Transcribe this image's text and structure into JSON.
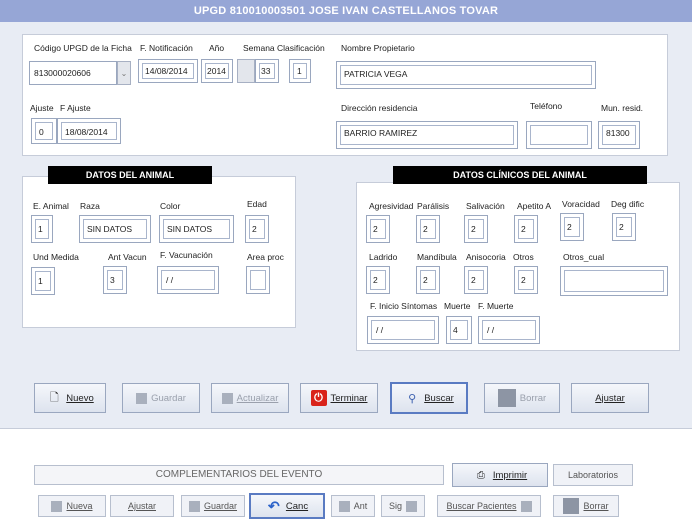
{
  "window": {
    "title": "UPGD 810010003501 JOSE IVAN CASTELLANOS TOVAR"
  },
  "top": {
    "labels": {
      "codigo": "Código UPGD de la Ficha",
      "notificacion": "F. Notificación",
      "anio": "Año",
      "semana": "Semana Clasificación",
      "propietario": "Nombre Propietario",
      "ajuste": "Ajuste",
      "fajuste": "F Ajuste",
      "direccion": "Dirección residencia",
      "telefono": "Teléfono",
      "mun": "Mun. resid."
    },
    "values": {
      "codigo": "813000020606",
      "notificacion": "14/08/2014",
      "anio": "2014",
      "semana": "33",
      "clasificacion": "1",
      "propietario": "PATRICIA VEGA",
      "ajuste": "0",
      "fajuste": "18/08/2014",
      "direccion": "BARRIO RAMIREZ",
      "telefono": "",
      "mun": "81300"
    }
  },
  "animal": {
    "header": "DATOS DEL ANIMAL",
    "labels": {
      "eanimal": "E. Animal",
      "raza": "Raza",
      "color": "Color",
      "edad": "Edad",
      "und": "Und Medida",
      "antvacun": "Ant Vacun",
      "fvacunacion": "F. Vacunación",
      "area": "Area proc"
    },
    "values": {
      "eanimal": "1",
      "raza": "SIN DATOS",
      "color": "SIN DATOS",
      "edad": "2",
      "und": "1",
      "antvacun": "3",
      "fvacunacion": "/ /",
      "area": ""
    }
  },
  "clinicos": {
    "header": "DATOS CLÍNICOS DEL ANIMAL",
    "labels": {
      "agresividad": "Agresividad",
      "paralisis": "Parálisis",
      "salivacion": "Salivación",
      "apetito": "Apetito A",
      "voracidad": "Voracidad",
      "degdific": "Deg dific",
      "ladrido": "Ladrido",
      "mandibula": "Mandíbula",
      "anisocoria": "Anisocoria",
      "otros": "Otros",
      "otroscual": "Otros_cual",
      "finicio": "F. Inicio Síntomas",
      "muerte": "Muerte",
      "fmuerte": "F. Muerte"
    },
    "values": {
      "agresividad": "2",
      "paralisis": "2",
      "salivacion": "2",
      "apetito": "2",
      "voracidad": "2",
      "degdific": "2",
      "ladrido": "2",
      "mandibula": "2",
      "anisocoria": "2",
      "otros": "2",
      "otroscual": "",
      "finicio": "/ /",
      "muerte": "4",
      "fmuerte": "/ /"
    }
  },
  "toolbar": {
    "nuevo": "Nuevo",
    "guardar": "Guardar",
    "actualizar": "Actualizar",
    "terminar": "Terminar",
    "buscar": "Buscar",
    "borrar": "Borrar",
    "ajustar": "Ajustar"
  },
  "bottom": {
    "complementarios": "COMPLEMENTARIOS DEL EVENTO",
    "imprimir": "Imprimir",
    "laboratorios": "Laboratorios",
    "nueva": "Nueva",
    "ajustar": "Ajustar",
    "guardar": "Guardar",
    "canc": "Canc",
    "ant": "Ant",
    "sig": "Sig",
    "buscar_pacientes": "Buscar Pacientes",
    "borrar": "Borrar"
  }
}
